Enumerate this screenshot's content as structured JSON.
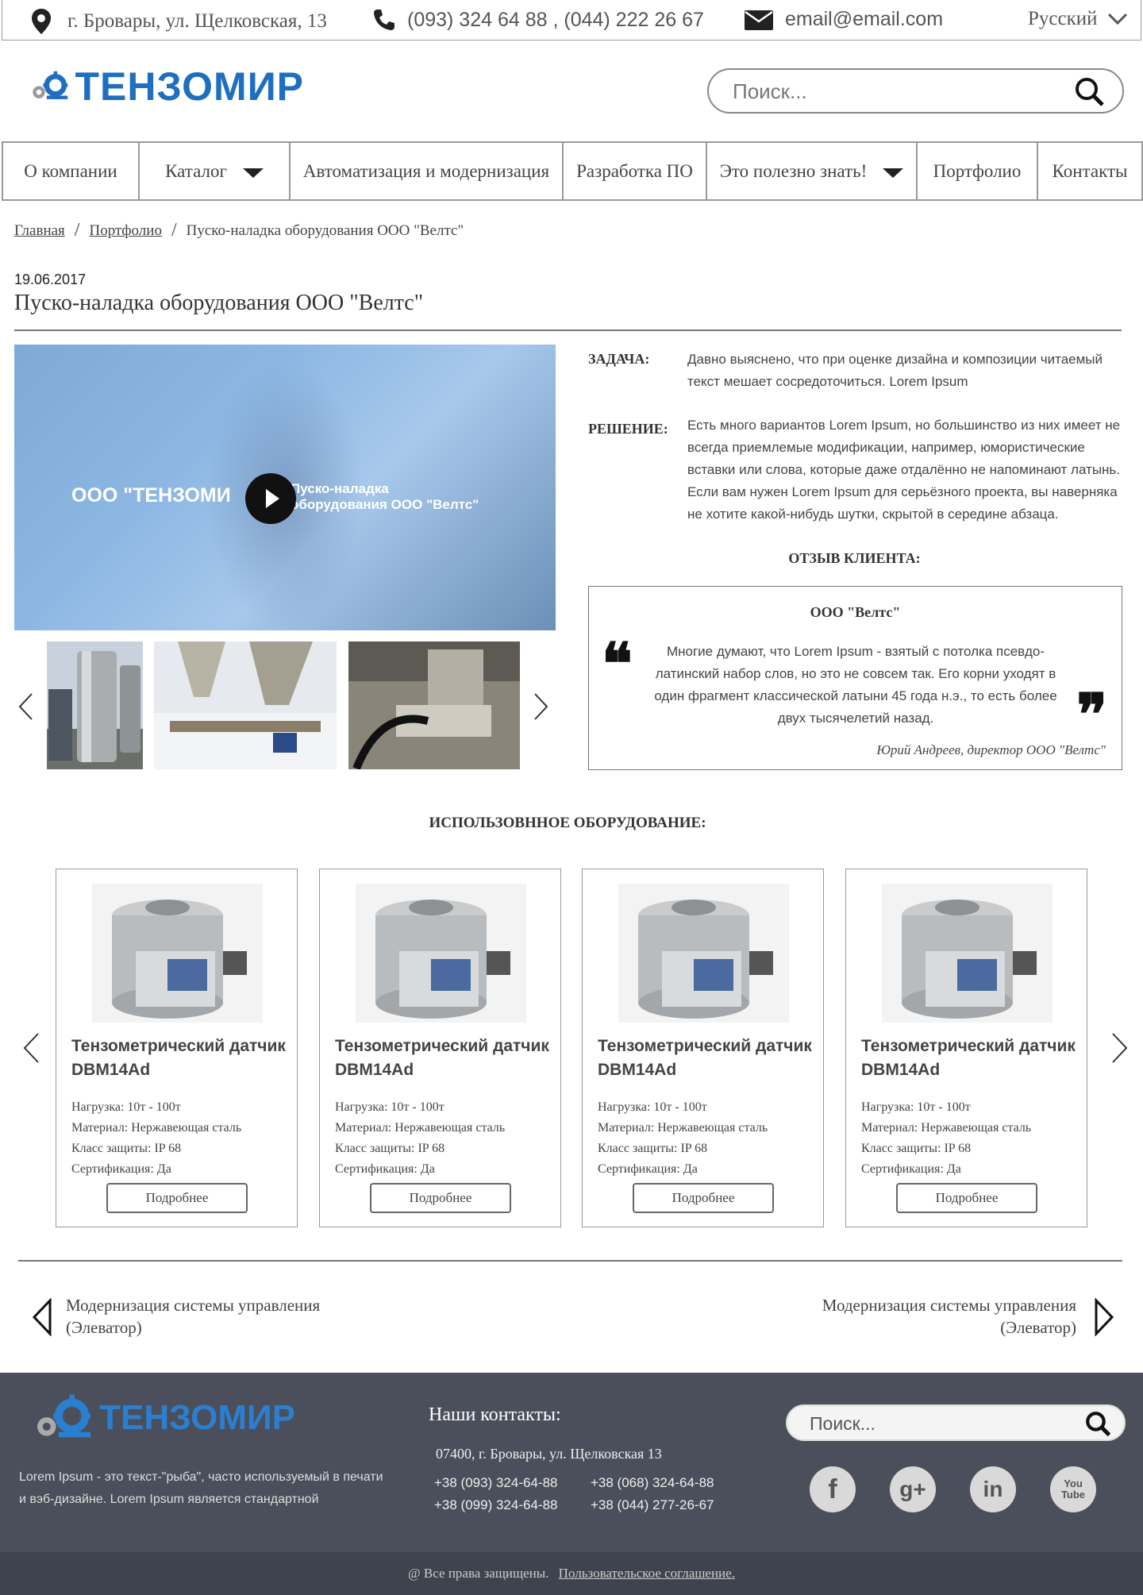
{
  "topbar": {
    "address": "г. Бровары, ул. Щелковская, 13",
    "phones": "(093) 324 64 88 , (044) 222 26 67",
    "email": "email@email.com",
    "language": "Русский",
    "icons": {
      "address": "map-pin-icon",
      "phone": "phone-icon",
      "email": "envelope-icon",
      "language": "chevron-down-icon"
    }
  },
  "header": {
    "logo_text": "ТЕНЗОМИР",
    "search_placeholder": "Поиск..."
  },
  "nav": [
    {
      "label": "О компании"
    },
    {
      "label": "Каталог",
      "dropdown": true
    },
    {
      "label": "Автоматизация и модернизация"
    },
    {
      "label": "Разработка ПО"
    },
    {
      "label": "Это полезно знать!",
      "dropdown": true
    },
    {
      "label": "Портфолио"
    },
    {
      "label": "Контакты"
    }
  ],
  "breadcrumb": [
    "Главная",
    "Портфолио",
    "Пуско-наладка оборудования ООО \"Велтс\""
  ],
  "post": {
    "date": "19.06.2017",
    "title": "Пуско-наладка оборудования ООО \"Велтс\"",
    "video_caption_left": "ООО \"ТЕНЗОМИ",
    "video_caption_right_1": "Пуско-наладка",
    "video_caption_right_2": "оборудования ООО \"Велтс\"",
    "task_label": "ЗАДАЧА:",
    "task_text": "Давно выяснено, что при оценке дизайна и композиции читаемый текст мешает сосредоточиться. Lorem Ipsum",
    "solution_label": "РЕШЕНИЕ:",
    "solution_text": "Есть много вариантов Lorem Ipsum, но большинство из них имеет не всегда приемлемые модификации, например, юмористические вставки или слова, которые даже отдалённо не напоминают латынь. Если вам нужен Lorem Ipsum для серьёзного проекта, вы наверняка не хотите какой-нибудь шутки, скрытой в середине абзаца."
  },
  "review": {
    "heading": "ОТЗЫВ КЛИЕНТА:",
    "company": "ООО \"Велтс\"",
    "text": "Многие думают, что Lorem Ipsum - взятый с потолка псевдо-латинский набор слов, но это не совсем так. Его корни уходят в один фрагмент классической латыни 45 года н.э., то есть более двух тысячелетий назад.",
    "author": "Юрий Андреев, директор ООО \"Велтс\"",
    "open_quote": "❝",
    "close_quote": "❞"
  },
  "equipment": {
    "heading": "ИСПОЛЬЗОВННОЕ ОБОРУДОВАНИЕ:",
    "cards": [
      {
        "name": "Тензометрический датчик DBM14Ad",
        "load": "Нагрузка: 10т - 100т",
        "material": "Материал: Нержавеющая сталь",
        "protection": "Класс защиты: IP 68",
        "cert": "Сертификация: Да",
        "button": "Подробнее"
      },
      {
        "name": "Тензометрический датчик DBM14Ad",
        "load": "Нагрузка: 10т - 100т",
        "material": "Материал: Нержавеющая сталь",
        "protection": "Класс защиты: IP 68",
        "cert": "Сертификация: Да",
        "button": "Подробнее"
      },
      {
        "name": "Тензометрический датчик DBM14Ad",
        "load": "Нагрузка: 10т - 100т",
        "material": "Материал: Нержавеющая сталь",
        "protection": "Класс защиты: IP 68",
        "cert": "Сертификация: Да",
        "button": "Подробнее"
      },
      {
        "name": "Тензометрический датчик DBM14Ad",
        "load": "Нагрузка: 10т - 100т",
        "material": "Материал: Нержавеющая сталь",
        "protection": "Класс защиты: IP 68",
        "cert": "Сертификация: Да",
        "button": "Подробнее"
      }
    ]
  },
  "post_nav": {
    "prev_line1": "Модернизация системы управления",
    "prev_line2": "(Элеватор)",
    "next_line1": "Модернизация системы управления",
    "next_line2": "(Элеватор)"
  },
  "footer": {
    "logo_text": "ТЕНЗОМИР",
    "description": "Lorem Ipsum - это текст-\"рыба\", часто используемый в печати и вэб-дизайне. Lorem Ipsum является стандартной",
    "contacts_title": "Наши контакты:",
    "address": "07400, г. Бровары, ул. Щелковская 13",
    "phones": [
      "+38 (093) 324-64-88",
      "+38 (068) 324-64-88",
      "+38 (099) 324-64-88",
      "+38 (044) 277-26-67"
    ],
    "search_placeholder": "Поиск...",
    "social": [
      {
        "icon": "facebook-icon",
        "glyph": "f"
      },
      {
        "icon": "google-plus-icon",
        "glyph": "g+"
      },
      {
        "icon": "linkedin-icon",
        "glyph": "in"
      },
      {
        "icon": "youtube-icon",
        "glyph": "You Tube"
      }
    ],
    "copyright": "@ Все права защищены.",
    "agreement_link": "Пользовательское соглашение."
  },
  "colors": {
    "brand_blue": "#1e6fbf",
    "footer_bg": "#4a4f5b",
    "bottombar_bg": "#3f434d"
  }
}
